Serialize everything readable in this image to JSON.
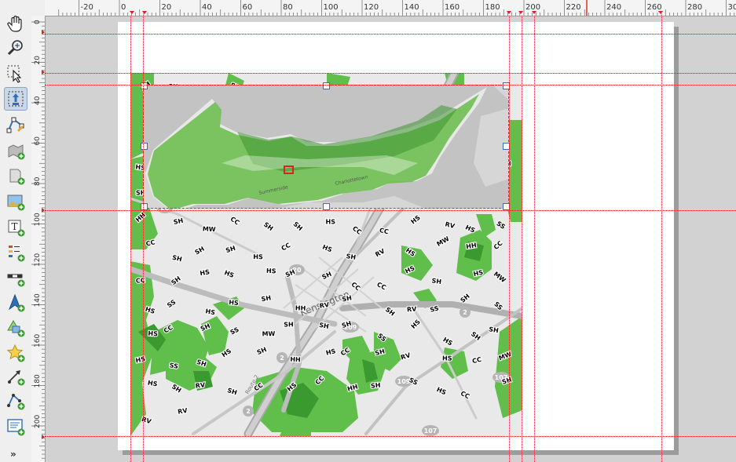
{
  "toolbar": {
    "tools": [
      "pan-icon",
      "zoom-icon",
      "select-icon",
      "move-item-content-icon",
      "edit-nodes-icon",
      "add-map-icon",
      "add-3d-map-icon",
      "add-picture-icon",
      "add-label-icon",
      "add-legend-icon",
      "add-scalebar-icon",
      "add-north-arrow-icon",
      "add-shape-icon",
      "add-marker-icon",
      "add-arrow-icon",
      "add-node-item-icon",
      "add-html-icon",
      "more-tools-icon"
    ],
    "more": "»"
  },
  "ruler_top": {
    "labels": [
      "-20",
      "0",
      "20",
      "40",
      "60",
      "80",
      "100",
      "120",
      "140",
      "160",
      "180",
      "200",
      "220",
      "240",
      "260",
      "280",
      "300"
    ]
  },
  "ruler_left": {
    "labels": [
      "0",
      "20",
      "40",
      "60",
      "80",
      "100",
      "120",
      "140",
      "160",
      "180",
      "200"
    ]
  },
  "map": {
    "place_labels": [
      "Kensington"
    ],
    "road_shields": [
      "20",
      "20",
      "109",
      "2",
      "2",
      "109",
      "107",
      "2",
      "107"
    ],
    "road_labels": [
      "Route 2"
    ],
    "zone_labels": [
      "SH",
      "SH",
      "SH",
      "SH",
      "SH",
      "SS",
      "MW",
      "SS",
      "SH",
      "SS",
      "SH",
      "SS",
      "HS",
      "SS",
      "MW",
      "SS",
      "HS",
      "MW",
      "SH",
      "HS",
      "HS",
      "HH",
      "HS",
      "SS",
      "SS",
      "SH",
      "SS",
      "SH",
      "CC",
      "SH",
      "CC",
      "SS",
      "RV",
      "SH",
      "RV",
      "SS",
      "CC",
      "SS",
      "SH",
      "HS",
      "HS",
      "CC",
      "SH",
      "SH",
      "CC",
      "SS",
      "SH",
      "RV",
      "SS",
      "SS",
      "SS",
      "SH",
      "SH",
      "CC",
      "SS",
      "SS",
      "CC",
      "HS",
      "HH",
      "SH",
      "CC",
      "HS",
      "RV",
      "MW",
      "HS",
      "HH",
      "SH",
      "MW",
      "CC",
      "SH",
      "SH",
      "HS",
      "CC",
      "CC",
      "HS",
      "RV",
      "HS",
      "SS",
      "CC",
      "SH",
      "SH",
      "SH",
      "HS",
      "CC",
      "HS",
      "SH",
      "RV",
      "HS",
      "MW",
      "HH",
      "CC",
      "CC",
      "SH",
      "HS",
      "HS",
      "HS",
      "SH",
      "SH",
      "CC",
      "CC",
      "HS",
      "SH",
      "HS",
      "MW",
      "HS",
      "SS",
      "HS",
      "HS",
      "SH",
      "HH",
      "RV",
      "SH",
      "SH",
      "RV",
      "SS",
      "SH",
      "SS",
      "HS",
      "CC",
      "SH",
      "SS",
      "MW",
      "SH",
      "SH",
      "SH",
      "SS",
      "HS",
      "HS",
      "SH",
      "SH",
      "HS",
      "SS",
      "SH",
      "HS",
      "SH",
      "HH",
      "HS",
      "CC",
      "SH",
      "RV",
      "HS",
      "CC",
      "MW",
      "HS",
      "SH",
      "RV",
      "SH",
      "CC",
      "HS",
      "CC",
      "HH",
      "SH",
      "SS",
      "HS",
      "CC",
      "SH",
      "RV",
      "RV"
    ],
    "overview_labels": [
      "Summerside",
      "Charlottetown"
    ]
  },
  "colors": {
    "accent_guide": "#e02020",
    "zone_green": "#5fbf4a",
    "zone_dark": "#3b9a2f",
    "basemap": "#e8e8e8",
    "overview_bg": "#c3c3c3",
    "handle_border": "#3c6db0"
  }
}
